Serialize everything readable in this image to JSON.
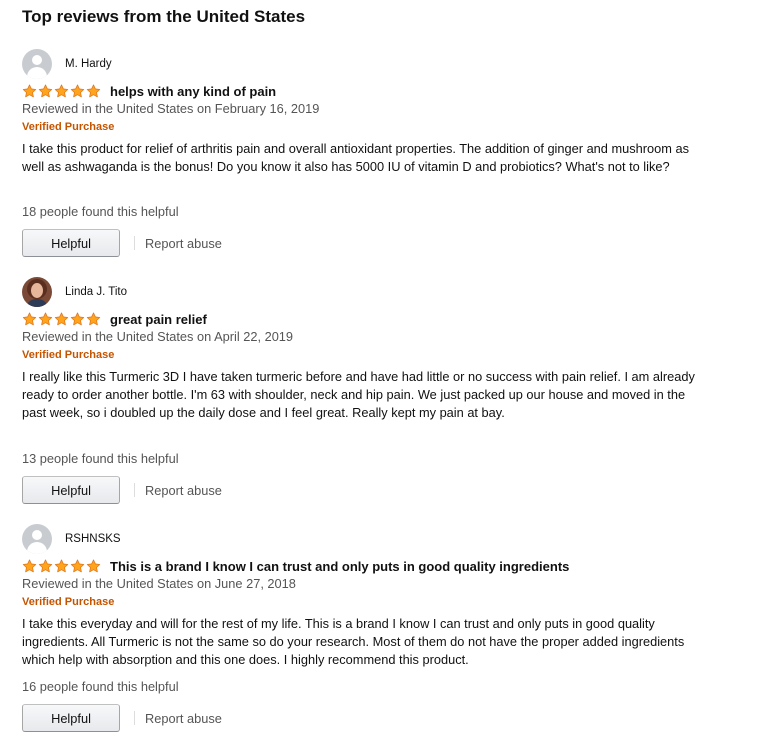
{
  "section_title": "Top reviews from the United States",
  "colors": {
    "star": "#ffa41c",
    "star_outline": "#de7921",
    "verified": "#c45500",
    "muted": "#555555"
  },
  "reviews": [
    {
      "profile_name": "M. Hardy",
      "avatar": "default-avatar-icon",
      "rating": 5,
      "title": "helps with any kind of pain",
      "date": "Reviewed in the United States on February 16, 2019",
      "verified": "Verified Purchase",
      "body": "I take this product for relief of arthritis pain and overall antioxidant properties. The addition of ginger and mushroom as well as ashwaganda is the bonus! Do you know it also has 5000 IU of vitamin D and probiotics? What's not to like?",
      "helpful_count": "18 people found this helpful",
      "helpful_label": "Helpful",
      "report_label": "Report abuse"
    },
    {
      "profile_name": "Linda J. Tito",
      "avatar": "profile-photo",
      "rating": 5,
      "title": "great pain relief",
      "date": "Reviewed in the United States on April 22, 2019",
      "verified": "Verified Purchase",
      "body": "I really like this Turmeric 3D I have taken turmeric before and have had little or no success with pain relief. I am already ready to order another bottle. I'm 63 with shoulder, neck and hip pain. We just packed up our house and moved in the past week, so i doubled up the daily dose and I feel great. Really kept my pain at bay.",
      "helpful_count": "13 people found this helpful",
      "helpful_label": "Helpful",
      "report_label": "Report abuse"
    },
    {
      "profile_name": "RSHNSKS",
      "avatar": "default-avatar-icon",
      "rating": 5,
      "title": "This is a brand I know I can trust and only puts in good quality ingredients",
      "date": "Reviewed in the United States on June 27, 2018",
      "verified": "Verified Purchase",
      "body": "I take this everyday and will for the rest of my life. This is a brand I know I can trust and only puts in good quality ingredients. All Turmeric is not the same so do your research. Most of them do not have the proper added ingredients which help with absorption and this one does. I highly recommend this product.",
      "helpful_count": "16 people found this helpful",
      "helpful_label": "Helpful",
      "report_label": "Report abuse"
    }
  ]
}
